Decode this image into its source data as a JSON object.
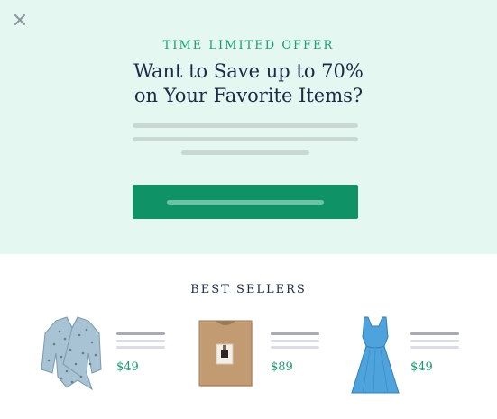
{
  "hero": {
    "close_symbol": "×",
    "eyebrow": "TIME LIMITED OFFER",
    "headline_line1": "Want to Save up to 70%",
    "headline_line2": "on Your Favorite Items?"
  },
  "best_sellers": {
    "title": "BEST SELLERS",
    "products": [
      {
        "icon": "wrap-blouse-icon",
        "price": "$49"
      },
      {
        "icon": "folded-sweater-icon",
        "price": "$89"
      },
      {
        "icon": "blue-dress-icon",
        "price": "$49"
      }
    ]
  },
  "colors": {
    "hero_bg": "#e4f8f1",
    "accent": "#0e9266",
    "heading": "#1b2a47",
    "price": "#1a9b72"
  }
}
